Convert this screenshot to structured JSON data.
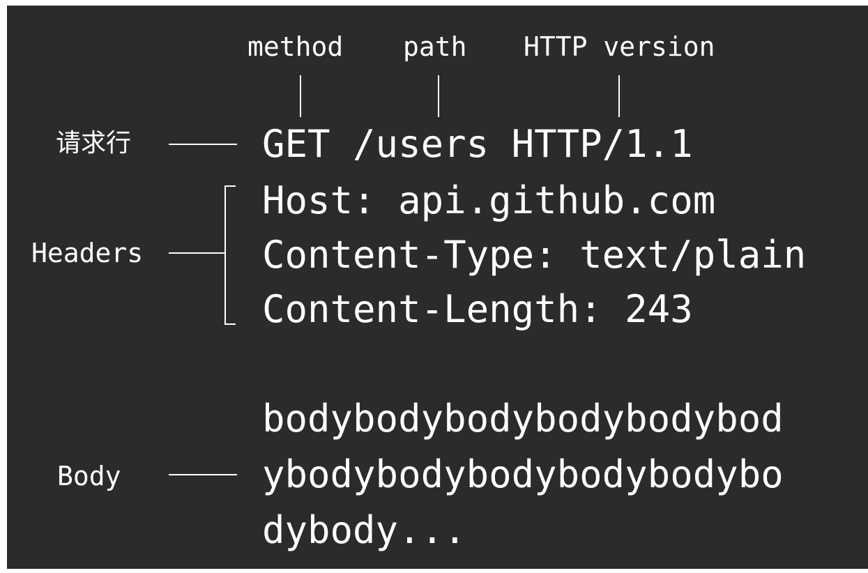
{
  "labels": {
    "method": "method",
    "path": "path",
    "http_version": "HTTP version",
    "request_line": "请求行",
    "headers": "Headers",
    "body": "Body"
  },
  "request": {
    "request_line": "GET /users HTTP/1.1",
    "headers": [
      "Host: api.github.com",
      "Content-Type: text/plain",
      "Content-Length: 243"
    ],
    "body_lines": [
      "bodybodybodybodybodybod",
      "ybodybodybodybodybodybo",
      "dybody..."
    ]
  },
  "colors": {
    "background": "#2b2b2b",
    "foreground": "#ffffff"
  }
}
